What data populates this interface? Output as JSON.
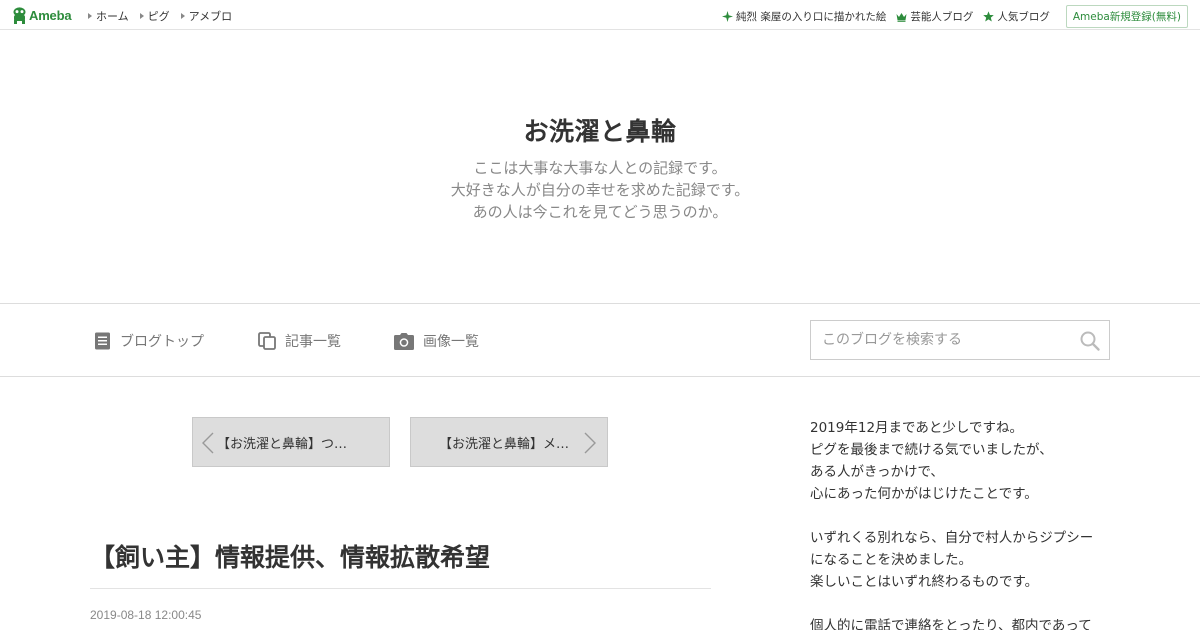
{
  "topbar": {
    "logo_text": "Ameba",
    "nav": [
      "ホーム",
      "ピグ",
      "アメブロ"
    ],
    "links": [
      {
        "label": "純烈 楽屋の入り口に描かれた絵",
        "icon": "sparkle-icon"
      },
      {
        "label": "芸能人ブログ",
        "icon": "crown-icon"
      },
      {
        "label": "人気ブログ",
        "icon": "star-icon"
      }
    ],
    "register_label": "Ameba新規登録(無料)",
    "accent": "#2d8c3c"
  },
  "header": {
    "title": "お洗濯と鼻輪",
    "description": [
      "ここは大事な大事な人との記録です。",
      "大好きな人が自分の幸せを求めた記録です。",
      "あの人は今これを見てどう思うのか。"
    ]
  },
  "navbar": {
    "items": [
      {
        "label": "ブログトップ",
        "icon": "document-icon"
      },
      {
        "label": "記事一覧",
        "icon": "copy-icon"
      },
      {
        "label": "画像一覧",
        "icon": "camera-icon"
      }
    ],
    "search_placeholder": "このブログを検索する",
    "search_icon": "search-icon"
  },
  "pager": {
    "prev_label": "【お洗濯と鼻輪】つ…",
    "next_label": "【お洗濯と鼻輪】メ…"
  },
  "entry": {
    "title": "【飼い主】情報提供、情報拡散希望",
    "date": "2019-08-18 12:00:45"
  },
  "sidebar": {
    "paragraphs": [
      [
        "2019年12月まであと少しですね。",
        "ピグを最後まで続ける気でいましたが、",
        "ある人がきっかけで、",
        "心にあった何かがはじけたことです。"
      ],
      [
        "いずれくる別れなら、自分で村人からジプシー",
        "になることを決めました。",
        "楽しいことはいずれ終わるものです。"
      ],
      [
        "個人的に電話で連絡をとったり、都内であって"
      ]
    ]
  }
}
